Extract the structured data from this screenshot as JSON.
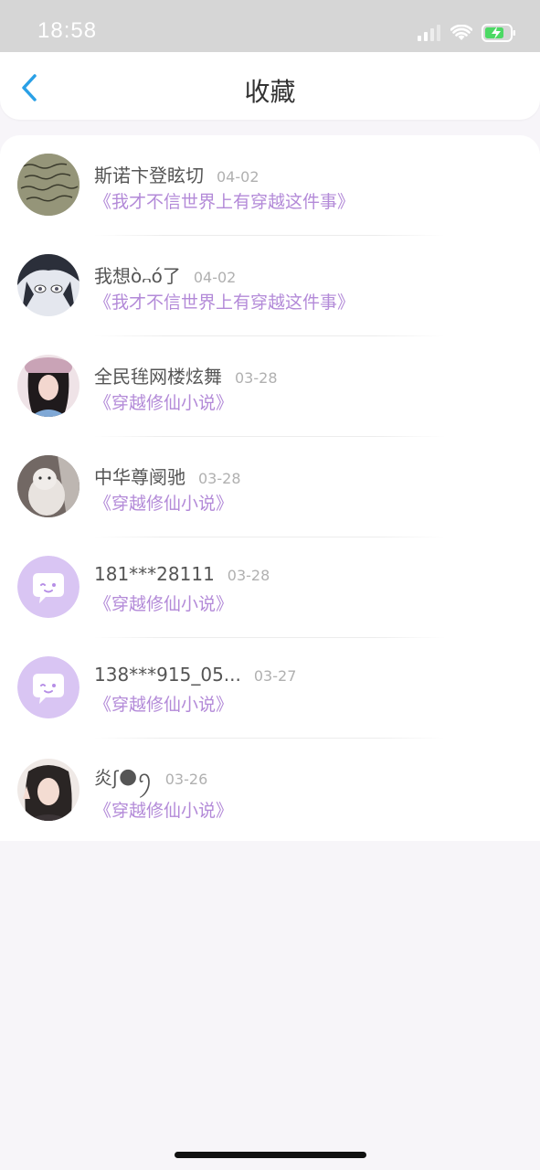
{
  "status": {
    "time": "18:58",
    "icons": [
      "signal-icon",
      "wifi-icon",
      "battery-charging-icon"
    ],
    "battery_color": "#4cd964"
  },
  "nav": {
    "back_icon": "chevron-left-icon",
    "title": "收藏",
    "accent_color": "#2aa0e6"
  },
  "favorites": [
    {
      "name": "斯诺卞登眩切",
      "date": "04-02",
      "book": "《我才不信世界上有穿越这件事》",
      "avatar": "handwriting-photo"
    },
    {
      "name": "我想ò᎔ó了",
      "date": "04-02",
      "book": "《我才不信世界上有穿越这件事》",
      "avatar": "anime-girl-photo"
    },
    {
      "name": "全民毪网楼炫舞",
      "date": "03-28",
      "book": "《穿越修仙小说》",
      "avatar": "girl-in-hat-photo"
    },
    {
      "name": "中华尊阌驰",
      "date": "03-28",
      "book": "《穿越修仙小说》",
      "avatar": "white-cat-photo"
    },
    {
      "name": "181***28111",
      "date": "03-28",
      "book": "《穿越修仙小说》",
      "avatar": "default-chat-bubble"
    },
    {
      "name": "138***915_05...",
      "date": "03-27",
      "book": "《穿越修仙小说》",
      "avatar": "default-chat-bubble"
    },
    {
      "name": "炎ʃ🌑ꪆ",
      "date": "03-26",
      "book": "《穿越修仙小说》",
      "avatar": "girl-peace-sign-photo"
    }
  ],
  "colors": {
    "book_title": "#b38ad8",
    "default_avatar": "#d9c5f3"
  }
}
